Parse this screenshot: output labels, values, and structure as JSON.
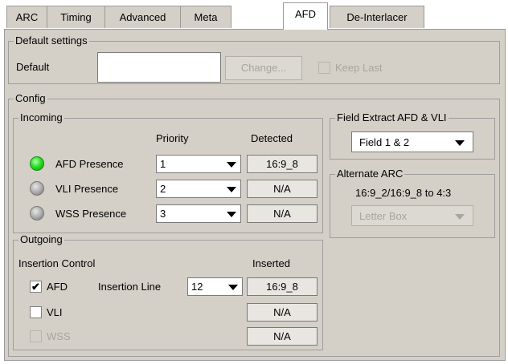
{
  "tabs": [
    "ARC",
    "Timing",
    "Advanced",
    "Meta",
    "AFD",
    "De-Interlacer"
  ],
  "default_settings": {
    "legend": "Default settings",
    "default_label": "Default",
    "default_value": "",
    "change_label": "Change...",
    "keep_last_label": "Keep Last"
  },
  "config": {
    "legend": "Config",
    "incoming": {
      "legend": "Incoming",
      "priority_header": "Priority",
      "detected_header": "Detected",
      "rows": [
        {
          "label": "AFD Presence",
          "priority": "1",
          "detected": "16:9_8",
          "led": "green"
        },
        {
          "label": "VLI Presence",
          "priority": "2",
          "detected": "N/A",
          "led": "grey"
        },
        {
          "label": "WSS Presence",
          "priority": "3",
          "detected": "N/A",
          "led": "grey"
        }
      ]
    },
    "outgoing": {
      "legend": "Outgoing",
      "insertion_control_label": "Insertion Control",
      "inserted_header": "Inserted",
      "insertion_line_label": "Insertion Line",
      "insertion_line_value": "12",
      "rows": [
        {
          "label": "AFD",
          "checked": true,
          "enabled": true,
          "inserted": "16:9_8"
        },
        {
          "label": "VLI",
          "checked": false,
          "enabled": true,
          "inserted": "N/A"
        },
        {
          "label": "WSS",
          "checked": false,
          "enabled": false,
          "inserted": "N/A"
        }
      ]
    },
    "field_extract": {
      "legend": "Field Extract AFD & VLI",
      "value": "Field 1 & 2"
    },
    "alternate_arc": {
      "legend": "Alternate ARC",
      "description": "16:9_2/16:9_8 to 4:3",
      "value": "Letter Box"
    }
  },
  "colors": {
    "panel_bg": "#d4d0c8",
    "led_on": "#29e024",
    "led_off": "#a9a9a9"
  }
}
